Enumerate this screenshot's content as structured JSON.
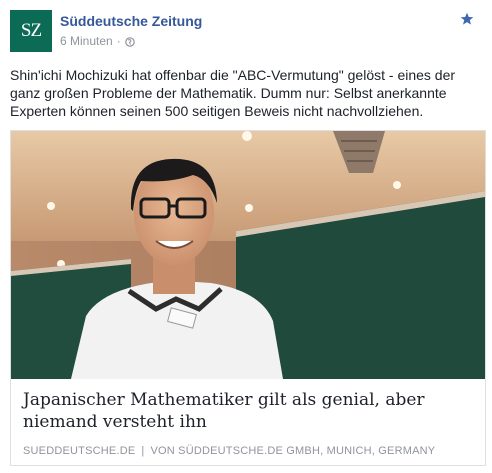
{
  "post": {
    "avatar_text": "SZ",
    "page_name": "Süddeutsche Zeitung",
    "timestamp": "6 Minuten",
    "separator": "·",
    "privacy_icon": "globe-icon",
    "star_icon": "star-icon",
    "text": "Shin'ichi Mochizuki hat offenbar die \"ABC-Vermutung\" gelöst - eines der ganz großen Probleme der Mathematik. Dumm nur: Selbst anerkannte Experten können seinen 500 seitigen Beweis nicht nachvollziehen."
  },
  "link": {
    "title": "Japanischer Mathematiker gilt als genial, aber niemand versteht ihn",
    "domain": "SUEDDEUTSCHE.DE",
    "divider": "|",
    "byline": "VON SÜDDEUTSCHE.DE GMBH, MUNICH, GERMANY"
  },
  "colors": {
    "avatar_bg": "#0b6b55",
    "page_name": "#365899",
    "star": "#4267b2",
    "meta": "#90949c",
    "chalkboard": "#1f4a3c"
  }
}
